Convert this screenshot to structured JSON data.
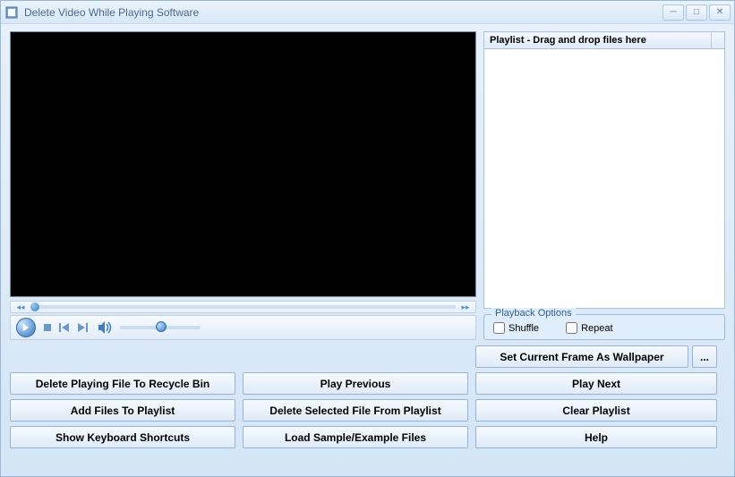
{
  "window": {
    "title": "Delete Video While Playing Software"
  },
  "playlist": {
    "header": "Playlist - Drag and drop files here"
  },
  "playback_options": {
    "legend": "Playback Options",
    "shuffle": "Shuffle",
    "repeat": "Repeat"
  },
  "buttons": {
    "set_wallpaper": "Set Current Frame As Wallpaper",
    "browse": "...",
    "delete_playing": "Delete Playing File To Recycle Bin",
    "play_previous": "Play Previous",
    "play_next": "Play Next",
    "add_files": "Add Files To Playlist",
    "delete_selected": "Delete Selected File From Playlist",
    "clear_playlist": "Clear Playlist",
    "show_shortcuts": "Show Keyboard Shortcuts",
    "load_sample": "Load Sample/Example Files",
    "help": "Help"
  }
}
